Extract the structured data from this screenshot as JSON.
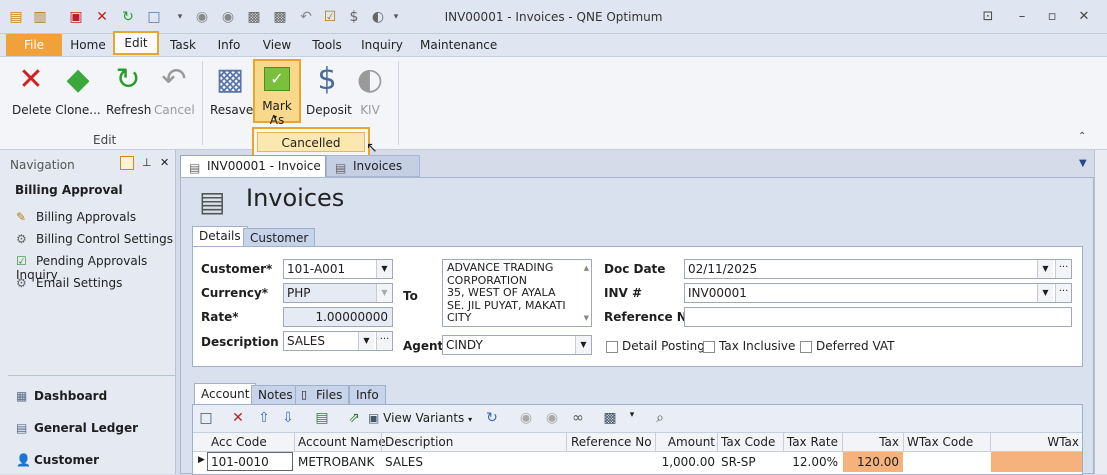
{
  "window": {
    "title": "INV00001 - Invoices - QNE Optimum"
  },
  "ribbon_tabs": [
    "File",
    "Home",
    "Edit",
    "Task",
    "Info",
    "View",
    "Tools",
    "Inquiry",
    "Maintenance"
  ],
  "ribbon": {
    "delete": "Delete",
    "clone": "Clone...",
    "refresh": "Refresh",
    "cancel": "Cancel",
    "edit_group": "Edit",
    "resave": "Resave",
    "mark_as": "Mark As",
    "deposit": "Deposit",
    "kiv": "KIV",
    "dropdown_item": "Cancelled"
  },
  "navigation": {
    "header": "Navigation",
    "section": "Billing Approval",
    "items": [
      "Billing Approvals",
      "Billing Control Settings",
      "Pending Approvals Inquiry",
      "Email Settings"
    ],
    "modules": [
      "Dashboard",
      "General Ledger",
      "Customer"
    ]
  },
  "doc_tabs": [
    "INV00001 - Invoice",
    "Invoices"
  ],
  "page_title": "Invoices",
  "sub_tabs": [
    "Details",
    "Customer"
  ],
  "form": {
    "customer_label": "Customer*",
    "customer_value": "101-A001",
    "currency_label": "Currency*",
    "currency_value": "PHP",
    "rate_label": "Rate*",
    "rate_value": "1.00000000",
    "description_label": "Description",
    "description_value": "SALES",
    "to_label": "To",
    "to_lines": [
      "ADVANCE TRADING",
      "CORPORATION",
      "35, WEST OF AYALA",
      "SE. JIL PUYAT, MAKATI",
      "CITY"
    ],
    "agent_label": "Agent",
    "agent_value": "CINDY",
    "docdate_label": "Doc Date",
    "docdate_value": "02/11/2025",
    "inv_label": "INV #",
    "inv_value": "INV00001",
    "ref_label": "Reference No",
    "ref_value": "",
    "detail_posting": "Detail Posting",
    "tax_inclusive": "Tax Inclusive",
    "deferred_vat": "Deferred VAT"
  },
  "lower_tabs": [
    "Account",
    "Notes",
    "Files",
    "Info"
  ],
  "grid": {
    "view_variants": "View Variants",
    "columns": [
      "Acc Code",
      "Account Name",
      "Description",
      "Reference No",
      "Amount",
      "Tax Code",
      "Tax Rate",
      "Tax",
      "WTax Code",
      "WTax"
    ],
    "rows": [
      [
        "101-0010",
        "METROBANK",
        "SALES",
        "",
        "1,000.00",
        "SR-SP",
        "12.00%",
        "120.00",
        "",
        ""
      ]
    ]
  }
}
